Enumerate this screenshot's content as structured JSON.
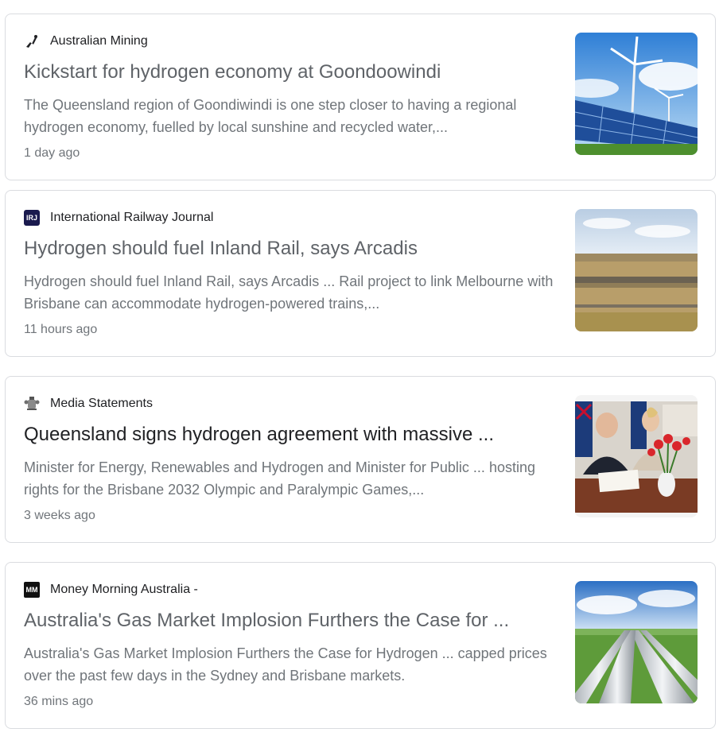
{
  "articles": [
    {
      "source": "Australian Mining",
      "source_icon": "australian-mining-logo-icon",
      "headline": "Kickstart for hydrogen economy at Goondoowindi",
      "snippet": "The Queensland region of Goondiwindi is one step closer to having a regional hydrogen economy, fuelled by local sunshine and recycled water,...",
      "time": "1 day ago",
      "thumbnail": "solar-wind-thumbnail"
    },
    {
      "source": "International Railway Journal",
      "source_icon": "irj-logo-icon",
      "source_icon_text": "IRJ",
      "headline": "Hydrogen should fuel Inland Rail, says Arcadis",
      "snippet": "Hydrogen should fuel Inland Rail, says Arcadis ... Rail project to link Melbourne with Brisbane can accommodate hydrogen-powered trains,...",
      "time": "11 hours ago",
      "thumbnail": "rail-plain-thumbnail"
    },
    {
      "source": "Media Statements",
      "source_icon": "queensland-crest-icon",
      "headline": "Queensland signs hydrogen agreement with massive ...",
      "snippet": "Minister for Energy, Renewables and Hydrogen and Minister for Public ... hosting rights for the Brisbane 2032 Olympic and Paralympic Games,...",
      "time": "3 weeks ago",
      "thumbnail": "signing-ceremony-thumbnail"
    },
    {
      "source": "Money Morning Australia -",
      "source_icon": "money-morning-logo-icon",
      "source_icon_text": "MM",
      "headline": "Australia's Gas Market Implosion Furthers the Case for ...",
      "snippet": "Australia's Gas Market Implosion Furthers the Case for Hydrogen ... capped prices over the past few days in the Sydney and Brisbane markets.",
      "time": "36 mins ago",
      "thumbnail": "gas-pipeline-thumbnail"
    }
  ],
  "colors": {
    "headline": "#5f6368",
    "headline_dark": "#202124",
    "snippet": "#70757a",
    "border": "#dadce0",
    "irj_badge": "#1a1a4e"
  }
}
